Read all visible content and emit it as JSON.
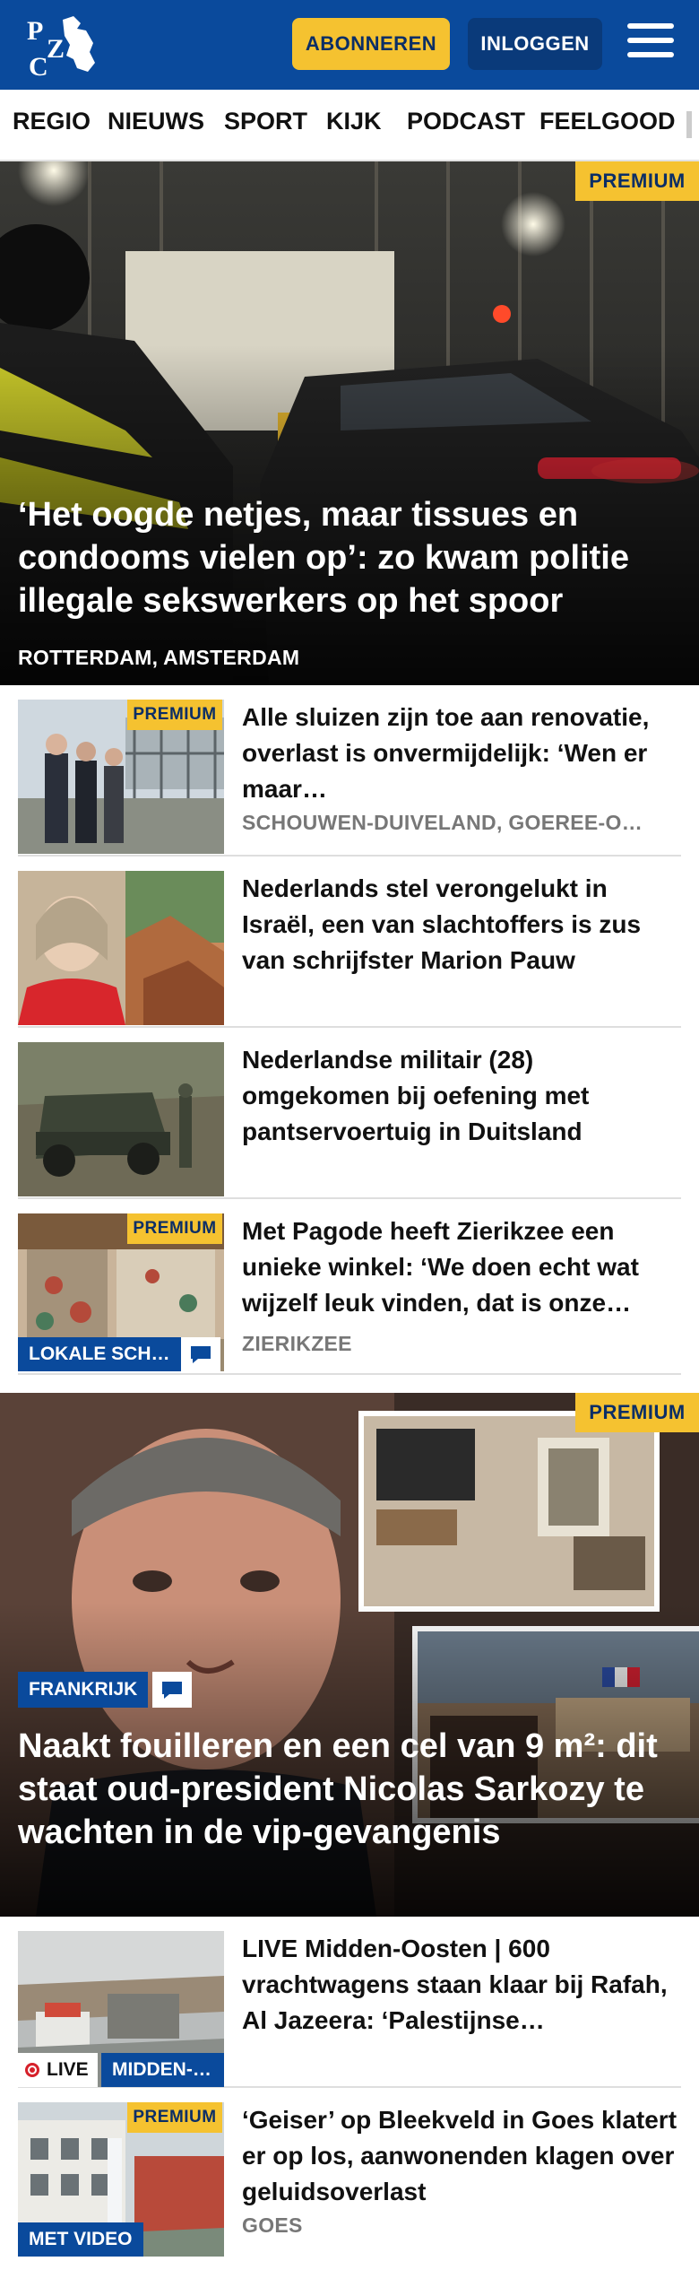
{
  "header": {
    "logo_text": "PZC",
    "subscribe_label": "ABONNEREN",
    "login_label": "INLOGGEN",
    "menu_icon": "hamburger-menu-icon",
    "brand_color": "#0a4a9c",
    "accent_color": "#f5c230"
  },
  "nav": {
    "items": [
      "REGIO",
      "NIEUWS",
      "SPORT",
      "KIJK",
      "PODCAST",
      "FEELGOOD"
    ]
  },
  "hero1": {
    "badge": "PREMIUM",
    "title": "‘Het oogde netjes, maar tissues en condooms vielen op’: zo kwam politie illegale sekswerkers op het spoor",
    "location": "ROTTERDAM, AMSTERDAM"
  },
  "articles": [
    {
      "badge": "PREMIUM",
      "title": "Alle sluizen zijn toe aan renovatie, overlast is onvermijdelijk: ‘Wen er maar…",
      "location": "SCHOUWEN-DUIVELAND, GOEREE-O…"
    },
    {
      "title": "Nederlands stel verongelukt in Israël, een van slachtoffers is zus van schrijfster Marion Pauw"
    },
    {
      "title": "Nederlandse militair (28) omgekomen bij oefening met pantservoertuig in Duitsland"
    },
    {
      "badge": "PREMIUM",
      "title": "Met Pagode heeft Zierikzee een unieke winkel: ‘We doen echt wat wijzelf leuk vinden, dat is onze…",
      "location": "ZIERIKZEE",
      "tag": "LOKALE SCH…"
    }
  ],
  "hero2": {
    "badge": "PREMIUM",
    "tag": "FRANKRIJK",
    "title": "Naakt fouilleren en een cel van 9 m²: dit staat oud-president Nicolas Sarkozy te wachten in de vip-gevangenis"
  },
  "articles2": [
    {
      "title": "LIVE Midden-Oosten | 600 vrachtwagens staan klaar bij Rafah, Al Jazeera: ‘Palestijnse…",
      "live_label": "LIVE",
      "tag": "MIDDEN-…"
    },
    {
      "badge": "PREMIUM",
      "title": "‘Geiser’ op Bleekveld in Goes klatert er op los, aanwonenden klagen over geluidsoverlast",
      "location": "GOES",
      "tag": "MET VIDEO"
    }
  ]
}
